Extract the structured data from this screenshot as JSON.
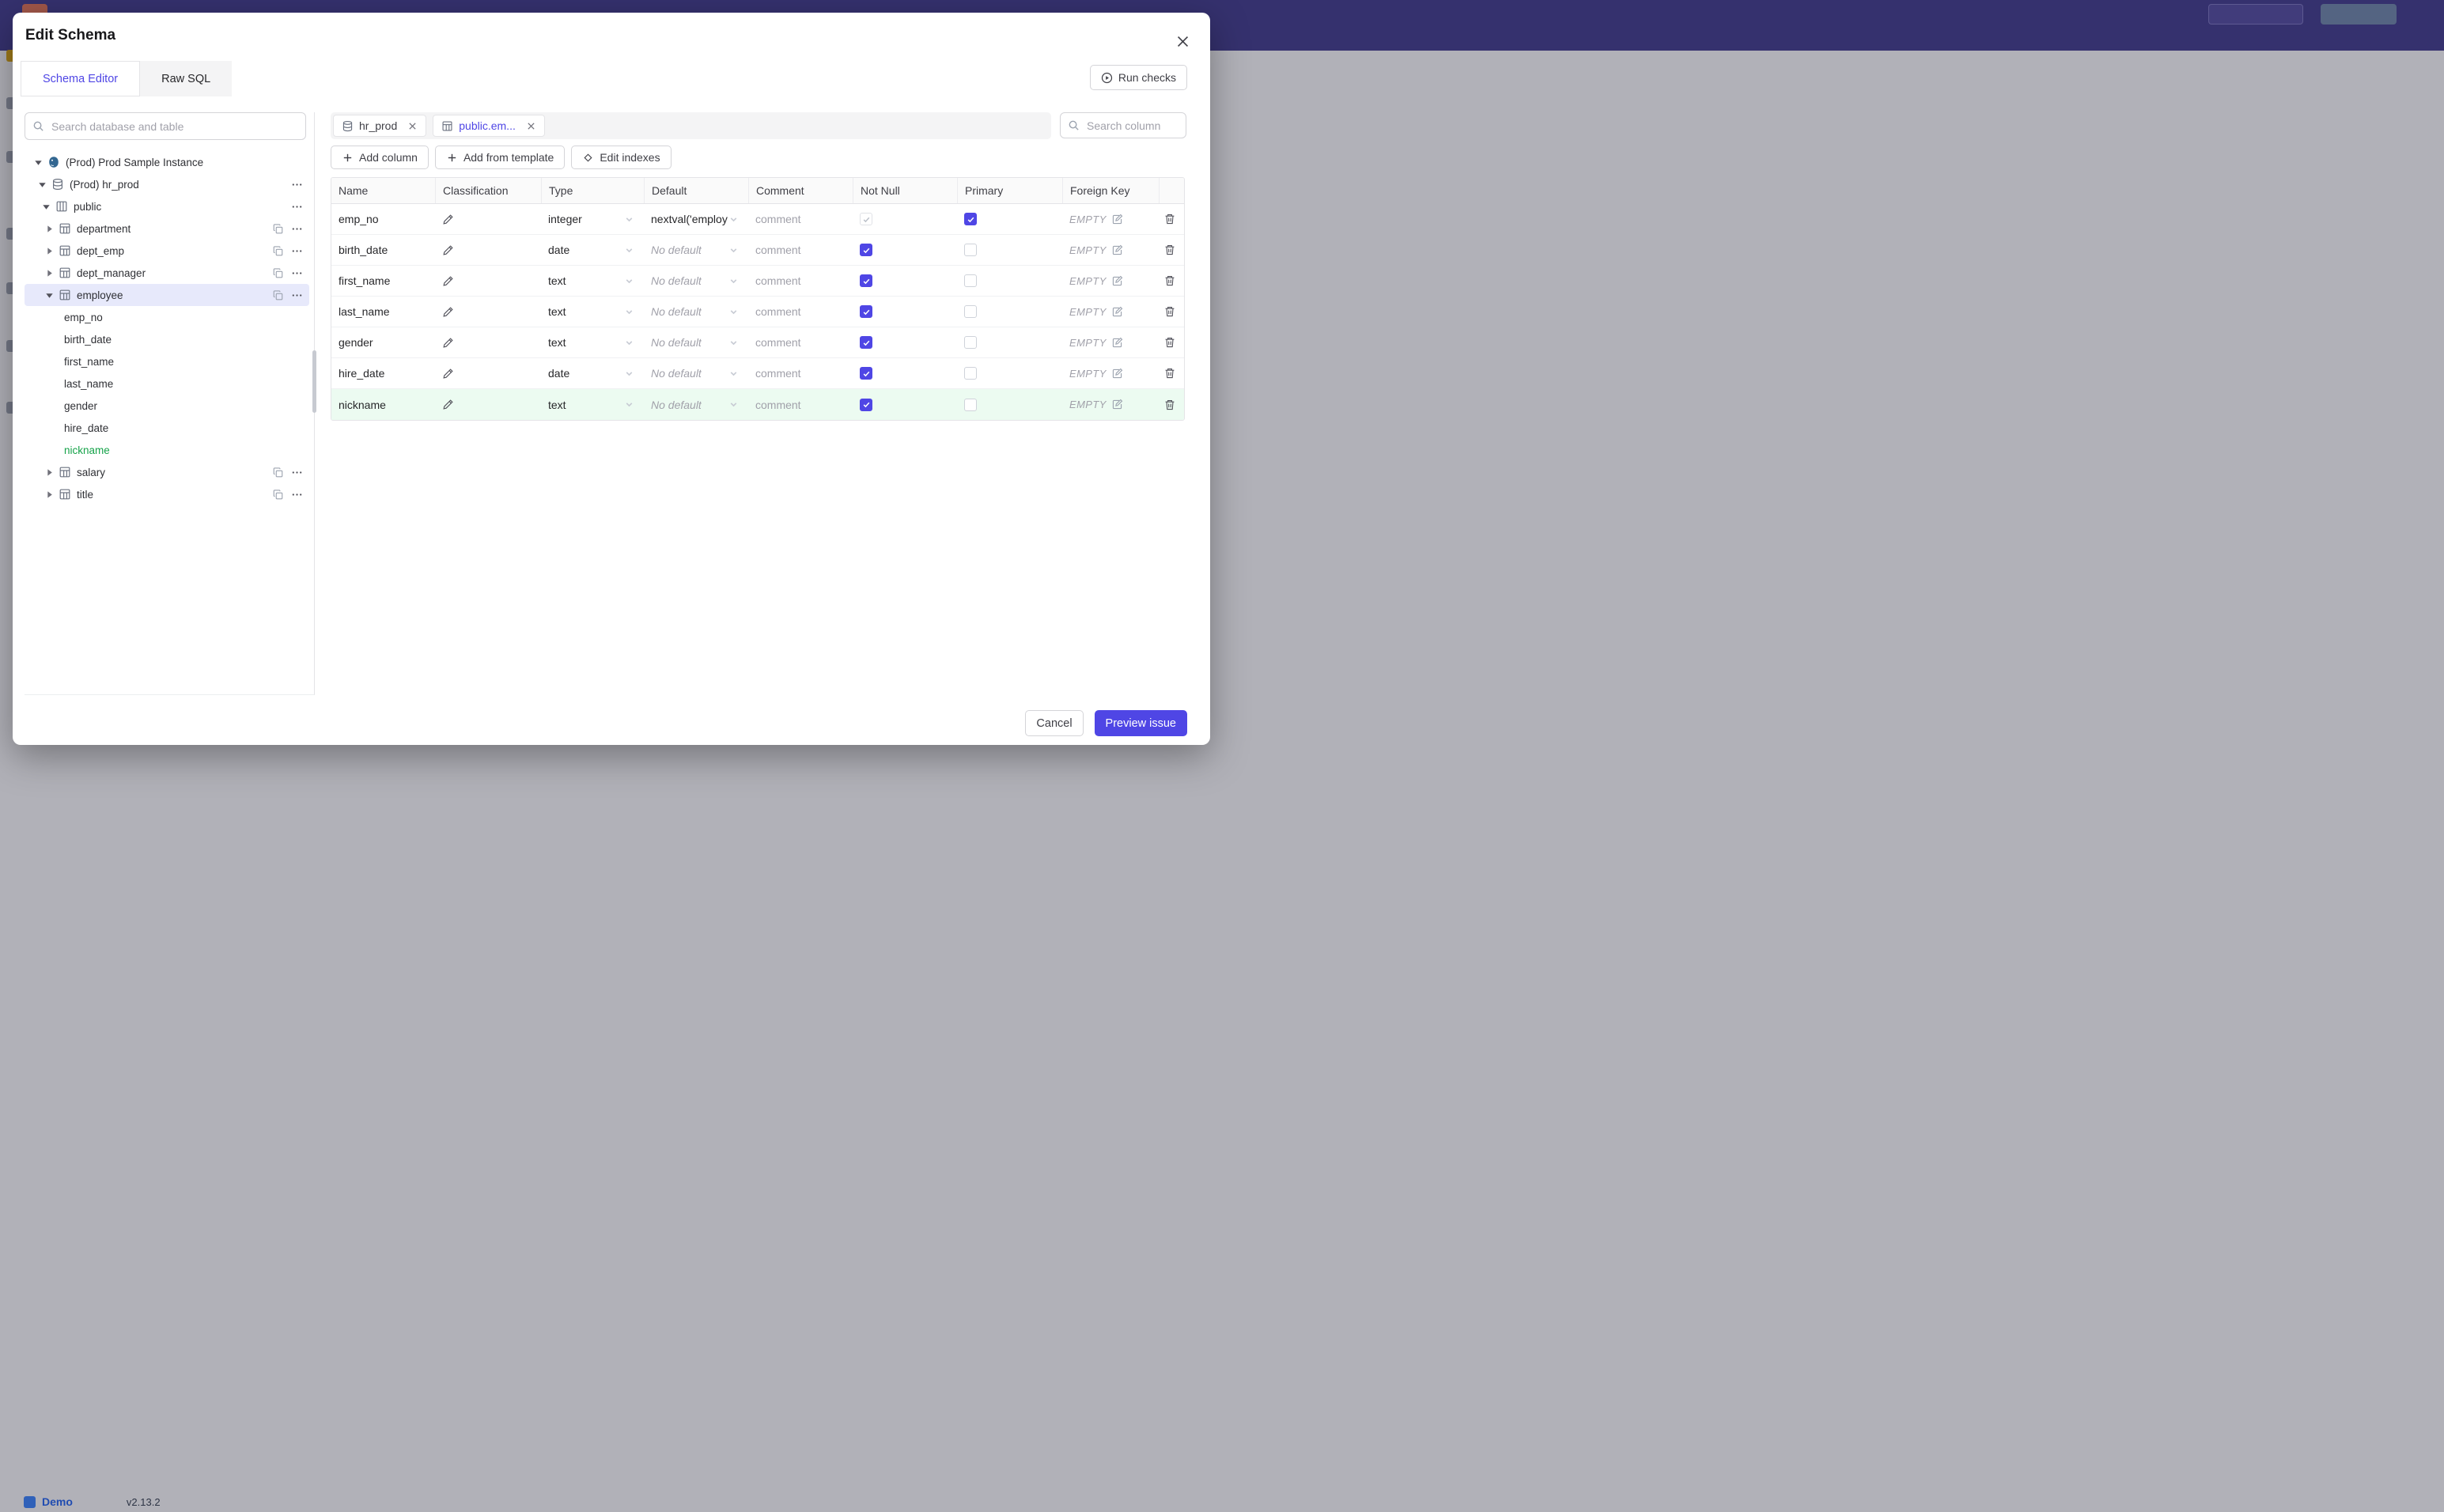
{
  "colors": {
    "accent": "#4f46e5",
    "new_item_green": "#16a34a",
    "new_row_bg": "#ecfbf1",
    "selected_tree_bg": "#e7e9fb",
    "topbar": "#433d8b"
  },
  "backdrop": {
    "demo_label": "Demo",
    "version": "v2.13.2"
  },
  "modal": {
    "title": "Edit Schema",
    "tabs": [
      {
        "label": "Schema Editor",
        "active": true
      },
      {
        "label": "Raw SQL",
        "active": false
      }
    ],
    "run_checks_label": "Run checks"
  },
  "left_panel": {
    "search_placeholder": "Search database and table",
    "tree": [
      {
        "label": "(Prod) Prod Sample Instance",
        "level": 0,
        "kind": "instance",
        "icon": "postgres-icon",
        "caret": "down"
      },
      {
        "label": "(Prod) hr_prod",
        "level": 1,
        "kind": "database",
        "icon": "database-icon",
        "caret": "down",
        "dots": true
      },
      {
        "label": "public",
        "level": 2,
        "kind": "schema",
        "icon": "schema-icon",
        "caret": "down",
        "dots": true
      },
      {
        "label": "department",
        "level": 3,
        "kind": "table",
        "icon": "table-icon",
        "caret": "right",
        "copy": true,
        "dots": true
      },
      {
        "label": "dept_emp",
        "level": 3,
        "kind": "table",
        "icon": "table-icon",
        "caret": "right",
        "copy": true,
        "dots": true
      },
      {
        "label": "dept_manager",
        "level": 3,
        "kind": "table",
        "icon": "table-icon",
        "caret": "right",
        "copy": true,
        "dots": true
      },
      {
        "label": "employee",
        "level": 3,
        "kind": "table",
        "icon": "table-icon",
        "caret": "down",
        "copy": true,
        "dots": true,
        "selected": true
      },
      {
        "label": "emp_no",
        "level": 4,
        "kind": "column"
      },
      {
        "label": "birth_date",
        "level": 4,
        "kind": "column"
      },
      {
        "label": "first_name",
        "level": 4,
        "kind": "column"
      },
      {
        "label": "last_name",
        "level": 4,
        "kind": "column"
      },
      {
        "label": "gender",
        "level": 4,
        "kind": "column"
      },
      {
        "label": "hire_date",
        "level": 4,
        "kind": "column"
      },
      {
        "label": "nickname",
        "level": 4,
        "kind": "column",
        "green": true
      },
      {
        "label": "salary",
        "level": 3,
        "kind": "table",
        "icon": "table-icon",
        "caret": "right",
        "copy": true,
        "dots": true
      },
      {
        "label": "title",
        "level": 3,
        "kind": "table",
        "icon": "table-icon",
        "caret": "right",
        "copy": true,
        "dots": true
      }
    ]
  },
  "editor": {
    "tabs": [
      {
        "label": "hr_prod",
        "icon": "database-icon",
        "active": false
      },
      {
        "label": "public.em...",
        "icon": "table-icon",
        "active": true
      }
    ],
    "search_placeholder": "Search column",
    "toolbar": {
      "add_column": "Add column",
      "add_from_template": "Add from template",
      "edit_indexes": "Edit indexes"
    },
    "table": {
      "headers": [
        "Name",
        "Classification",
        "Type",
        "Default",
        "Comment",
        "Not Null",
        "Primary",
        "Foreign Key"
      ],
      "rows": [
        {
          "name": "emp_no",
          "type": "integer",
          "default": "nextval('employ",
          "default_is_set": true,
          "comment_placeholder": "comment",
          "not_null": {
            "checked": true,
            "disabled": true
          },
          "primary": {
            "checked": true,
            "disabled": false
          },
          "foreign_key": "EMPTY",
          "highlight": false
        },
        {
          "name": "birth_date",
          "type": "date",
          "default": "No default",
          "default_is_set": false,
          "comment_placeholder": "comment",
          "not_null": {
            "checked": true,
            "disabled": false
          },
          "primary": {
            "checked": false,
            "disabled": false
          },
          "foreign_key": "EMPTY",
          "highlight": false
        },
        {
          "name": "first_name",
          "type": "text",
          "default": "No default",
          "default_is_set": false,
          "comment_placeholder": "comment",
          "not_null": {
            "checked": true,
            "disabled": false
          },
          "primary": {
            "checked": false,
            "disabled": false
          },
          "foreign_key": "EMPTY",
          "highlight": false
        },
        {
          "name": "last_name",
          "type": "text",
          "default": "No default",
          "default_is_set": false,
          "comment_placeholder": "comment",
          "not_null": {
            "checked": true,
            "disabled": false
          },
          "primary": {
            "checked": false,
            "disabled": false
          },
          "foreign_key": "EMPTY",
          "highlight": false
        },
        {
          "name": "gender",
          "type": "text",
          "default": "No default",
          "default_is_set": false,
          "comment_placeholder": "comment",
          "not_null": {
            "checked": true,
            "disabled": false
          },
          "primary": {
            "checked": false,
            "disabled": false
          },
          "foreign_key": "EMPTY",
          "highlight": false
        },
        {
          "name": "hire_date",
          "type": "date",
          "default": "No default",
          "default_is_set": false,
          "comment_placeholder": "comment",
          "not_null": {
            "checked": true,
            "disabled": false
          },
          "primary": {
            "checked": false,
            "disabled": false
          },
          "foreign_key": "EMPTY",
          "highlight": false
        },
        {
          "name": "nickname",
          "type": "text",
          "default": "No default",
          "default_is_set": false,
          "comment_placeholder": "comment",
          "not_null": {
            "checked": true,
            "disabled": false
          },
          "primary": {
            "checked": false,
            "disabled": false
          },
          "foreign_key": "EMPTY",
          "highlight": true
        }
      ]
    }
  },
  "footer": {
    "cancel_label": "Cancel",
    "primary_label": "Preview issue"
  }
}
